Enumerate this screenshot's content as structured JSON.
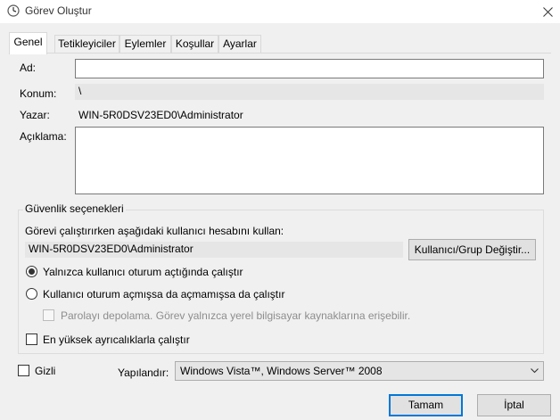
{
  "window": {
    "title": "Görev Oluştur"
  },
  "tabs": [
    {
      "label": "Genel"
    },
    {
      "label": "Tetikleyiciler"
    },
    {
      "label": "Eylemler"
    },
    {
      "label": "Koşullar"
    },
    {
      "label": "Ayarlar"
    }
  ],
  "general": {
    "name_label": "Ad:",
    "name_value": "",
    "location_label": "Konum:",
    "location_value": "\\",
    "author_label": "Yazar:",
    "author_value": "WIN-5R0DSV23ED0\\Administrator",
    "description_label": "Açıklama:",
    "description_value": ""
  },
  "security": {
    "group_title": "Güvenlik seçenekleri",
    "run_as_prompt": "Görevi çalıştırırken aşağıdaki kullanıcı hesabını kullan:",
    "account_value": "WIN-5R0DSV23ED0\\Administrator",
    "change_user_button": "Kullanıcı/Grup Değiştir...",
    "radio_logged_on": "Yalnızca kullanıcı oturum açtığında çalıştır",
    "radio_logged_on_checked": true,
    "radio_whether": "Kullanıcı oturum açmışsa da açmamışsa da çalıştır",
    "radio_whether_checked": false,
    "no_store_password": "Parolayı depolama. Görev yalnızca yerel bilgisayar kaynaklarına erişebilir.",
    "highest_privileges": "En yüksek ayrıcalıklarla çalıştır"
  },
  "bottom": {
    "hidden_label": "Gizli",
    "configure_label": "Yapılandır:",
    "configure_value": "Windows Vista™, Windows Server™ 2008"
  },
  "buttons": {
    "ok": "Tamam",
    "cancel": "İptal"
  },
  "colors": {
    "accent": "#0078d7",
    "background": "#f0f0f0",
    "field_readonly": "#e6e6e6"
  },
  "icons": {
    "app": "task-scheduler-clock-icon",
    "close": "close-icon",
    "dropdown": "chevron-down-icon"
  }
}
